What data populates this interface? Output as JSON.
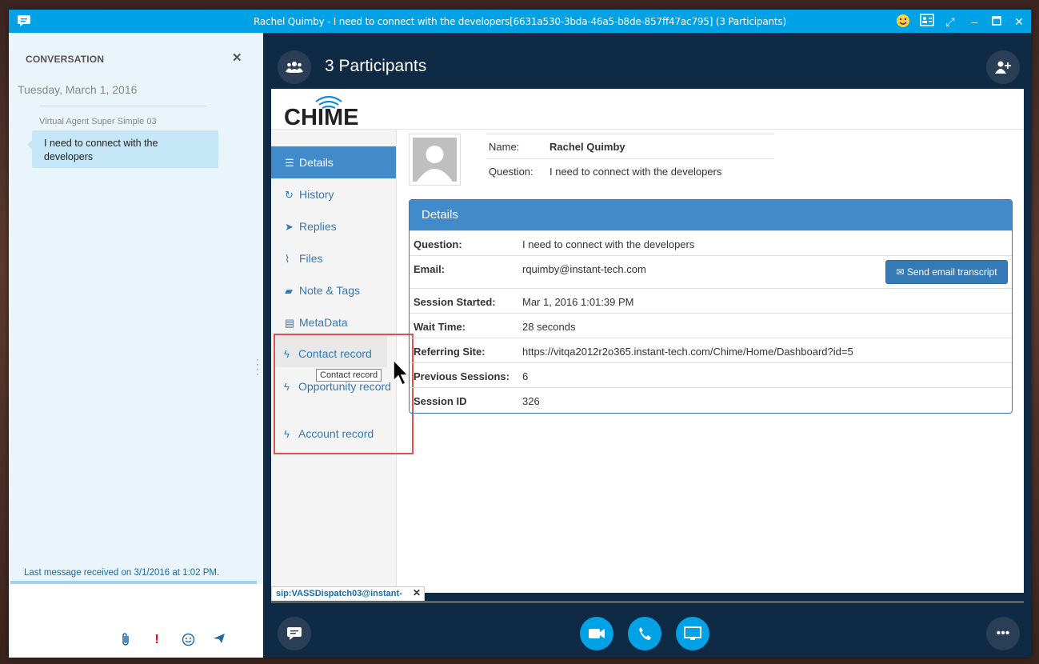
{
  "window": {
    "title": "Rachel Quimby - I need to connect with the developers[6631a530-3bda-46a5-b8de-857ff47ac795] (3 Participants)"
  },
  "conversation": {
    "header": "CONVERSATION",
    "date": "Tuesday, March 1, 2016",
    "sender": "Virtual Agent Super Simple 03",
    "message": "I need to connect with the developers",
    "last_message": "Last message received on 3/1/2016 at 1:02 PM."
  },
  "stage": {
    "participants_title": "3 Participants"
  },
  "nav": {
    "items": [
      {
        "label": "Details",
        "icon": "list-icon"
      },
      {
        "label": "History",
        "icon": "history-icon"
      },
      {
        "label": "Replies",
        "icon": "send-icon"
      },
      {
        "label": "Files",
        "icon": "paperclip-icon"
      },
      {
        "label": "Note & Tags",
        "icon": "comment-icon"
      },
      {
        "label": "MetaData",
        "icon": "table-icon"
      },
      {
        "label": "Contact record",
        "icon": "bolt-icon"
      },
      {
        "label": "Opportunity record",
        "icon": "bolt-icon"
      },
      {
        "label": "Account record",
        "icon": "bolt-icon"
      }
    ],
    "tooltip": "Contact record"
  },
  "profile": {
    "name_label": "Name:",
    "name_value": "Rachel Quimby",
    "question_label": "Question:",
    "question_value": "I need to connect with the developers"
  },
  "details": {
    "title": "Details",
    "email_button": "Send email transcript",
    "rows": [
      {
        "label": "Question:",
        "value": "I need to connect with the developers"
      },
      {
        "label": "Email:",
        "value": "rquimby@instant-tech.com"
      },
      {
        "label": "Session Started:",
        "value": "Mar 1, 2016 1:01:39 PM"
      },
      {
        "label": "Wait Time:",
        "value": "28 seconds"
      },
      {
        "label": "Referring Site:",
        "value": "https://vitqa2012r2o365.instant-tech.com/Chime/Home/Dashboard?id=5"
      },
      {
        "label": "Previous Sessions:",
        "value": "6"
      },
      {
        "label": "Session ID",
        "value": "326"
      }
    ]
  },
  "sip_tab": "sip:VASSDispatch03@instant-",
  "logo_text": "CHIME",
  "colors": {
    "titlebar": "#00a1e5",
    "stage": "#0f2a45",
    "accent": "#428bca",
    "highlight": "#d9534f"
  }
}
